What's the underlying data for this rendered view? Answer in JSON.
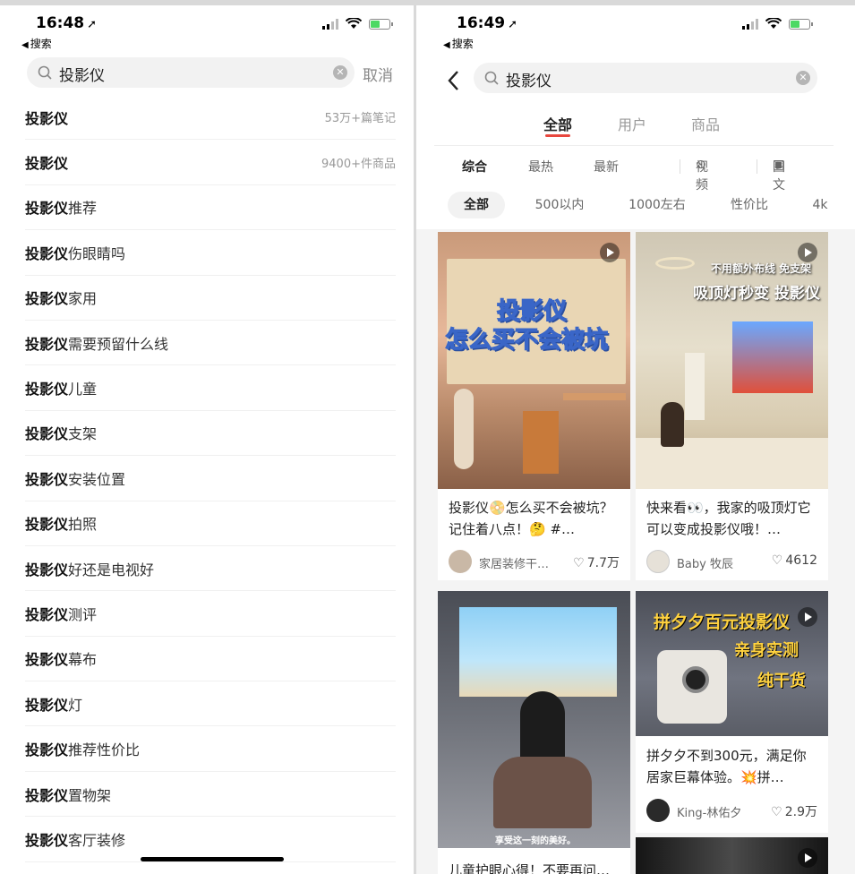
{
  "left": {
    "time": "16:48",
    "back_app": "搜索",
    "search_value": "投影仪",
    "cancel": "取消",
    "suggestions": [
      {
        "bold": "投影仪",
        "rest": "",
        "meta": "53万+篇笔记"
      },
      {
        "bold": "投影仪",
        "rest": "",
        "meta": "9400+件商品"
      },
      {
        "bold": "投影仪",
        "rest": "推荐",
        "meta": ""
      },
      {
        "bold": "投影仪",
        "rest": "伤眼睛吗",
        "meta": ""
      },
      {
        "bold": "投影仪",
        "rest": "家用",
        "meta": ""
      },
      {
        "bold": "投影仪",
        "rest": "需要预留什么线",
        "meta": ""
      },
      {
        "bold": "投影仪",
        "rest": "儿童",
        "meta": ""
      },
      {
        "bold": "投影仪",
        "rest": "支架",
        "meta": ""
      },
      {
        "bold": "投影仪",
        "rest": "安装位置",
        "meta": ""
      },
      {
        "bold": "投影仪",
        "rest": "拍照",
        "meta": ""
      },
      {
        "bold": "投影仪",
        "rest": "好还是电视好",
        "meta": ""
      },
      {
        "bold": "投影仪",
        "rest": "测评",
        "meta": ""
      },
      {
        "bold": "投影仪",
        "rest": "幕布",
        "meta": ""
      },
      {
        "bold": "投影仪",
        "rest": "灯",
        "meta": ""
      },
      {
        "bold": "投影仪",
        "rest": "推荐性价比",
        "meta": ""
      },
      {
        "bold": "投影仪",
        "rest": "置物架",
        "meta": ""
      },
      {
        "bold": "投影仪",
        "rest": "客厅装修",
        "meta": ""
      }
    ]
  },
  "right": {
    "time": "16:49",
    "back_app": "搜索",
    "search_value": "投影仪",
    "tabs": [
      "全部",
      "用户",
      "商品"
    ],
    "sort": [
      "综合",
      "最热",
      "最新",
      "视频",
      "图文"
    ],
    "chips": [
      "全部",
      "500以内",
      "1000左右",
      "性价比",
      "4k"
    ],
    "cards": [
      {
        "overlay_1": "投影仪",
        "overlay_2": "怎么买不会被坑",
        "title": "投影仪📀怎么买不会被坑？记住着八点！🤔 #…",
        "author": "家居装修干…",
        "likes": "7.7万"
      },
      {
        "overlay_1": "不用额外布线 免支架",
        "overlay_2": "吸顶灯秒变 投影仪",
        "title": "快来看👀，我家的吸顶灯它可以变成投影仪哦！…",
        "author": "Baby 牧辰",
        "likes": "4612"
      },
      {
        "overlay_1": "享受这一刻的美好。",
        "title": "儿童护眼心得！不要再问…"
      },
      {
        "overlay_1": "拼夕夕百元投影仪",
        "overlay_2": "亲身实测",
        "overlay_3": "纯干货",
        "title": "拼夕夕不到300元，满足你居家巨幕体验。💥拼…",
        "author": "King-林佑夕",
        "likes": "2.9万"
      }
    ]
  },
  "colors": {
    "accent": "#e8473e",
    "battery": "#4cd964"
  }
}
